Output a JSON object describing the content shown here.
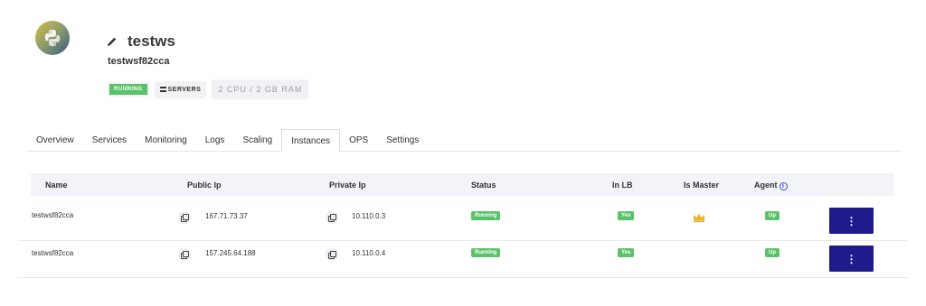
{
  "app": {
    "name": "testws",
    "id": "testwsf82cca",
    "status_badge": "RUNNING",
    "servers_badge": "SERVERS",
    "spec_badge": "2 CPU / 2 GB RAM"
  },
  "tabs": [
    {
      "label": "Overview"
    },
    {
      "label": "Services"
    },
    {
      "label": "Monitoring"
    },
    {
      "label": "Logs"
    },
    {
      "label": "Scaling"
    },
    {
      "label": "Instances"
    },
    {
      "label": "OPS"
    },
    {
      "label": "Settings"
    }
  ],
  "active_tab": "Instances",
  "table": {
    "headers": {
      "name": "Name",
      "public_ip": "Public Ip",
      "private_ip": "Private Ip",
      "status": "Status",
      "in_lb": "In LB",
      "is_master": "Is Master",
      "agent": "Agent"
    },
    "rows": [
      {
        "name": "testwsf82cca",
        "public_ip": "167.71.73.37",
        "private_ip": "10.110.0.3",
        "status": "Running",
        "in_lb": "Yes",
        "is_master": true,
        "agent": "Up",
        "menu": "⋮"
      },
      {
        "name": "testwsf82cca",
        "public_ip": "157.245.64.188",
        "private_ip": "10.110.0.4",
        "status": "Running",
        "in_lb": "Yes",
        "is_master": false,
        "agent": "Up",
        "menu": "⋮"
      }
    ]
  },
  "colors": {
    "accent": "#1f1b8c",
    "success": "#5bc26a",
    "crown": "#f0b429"
  }
}
